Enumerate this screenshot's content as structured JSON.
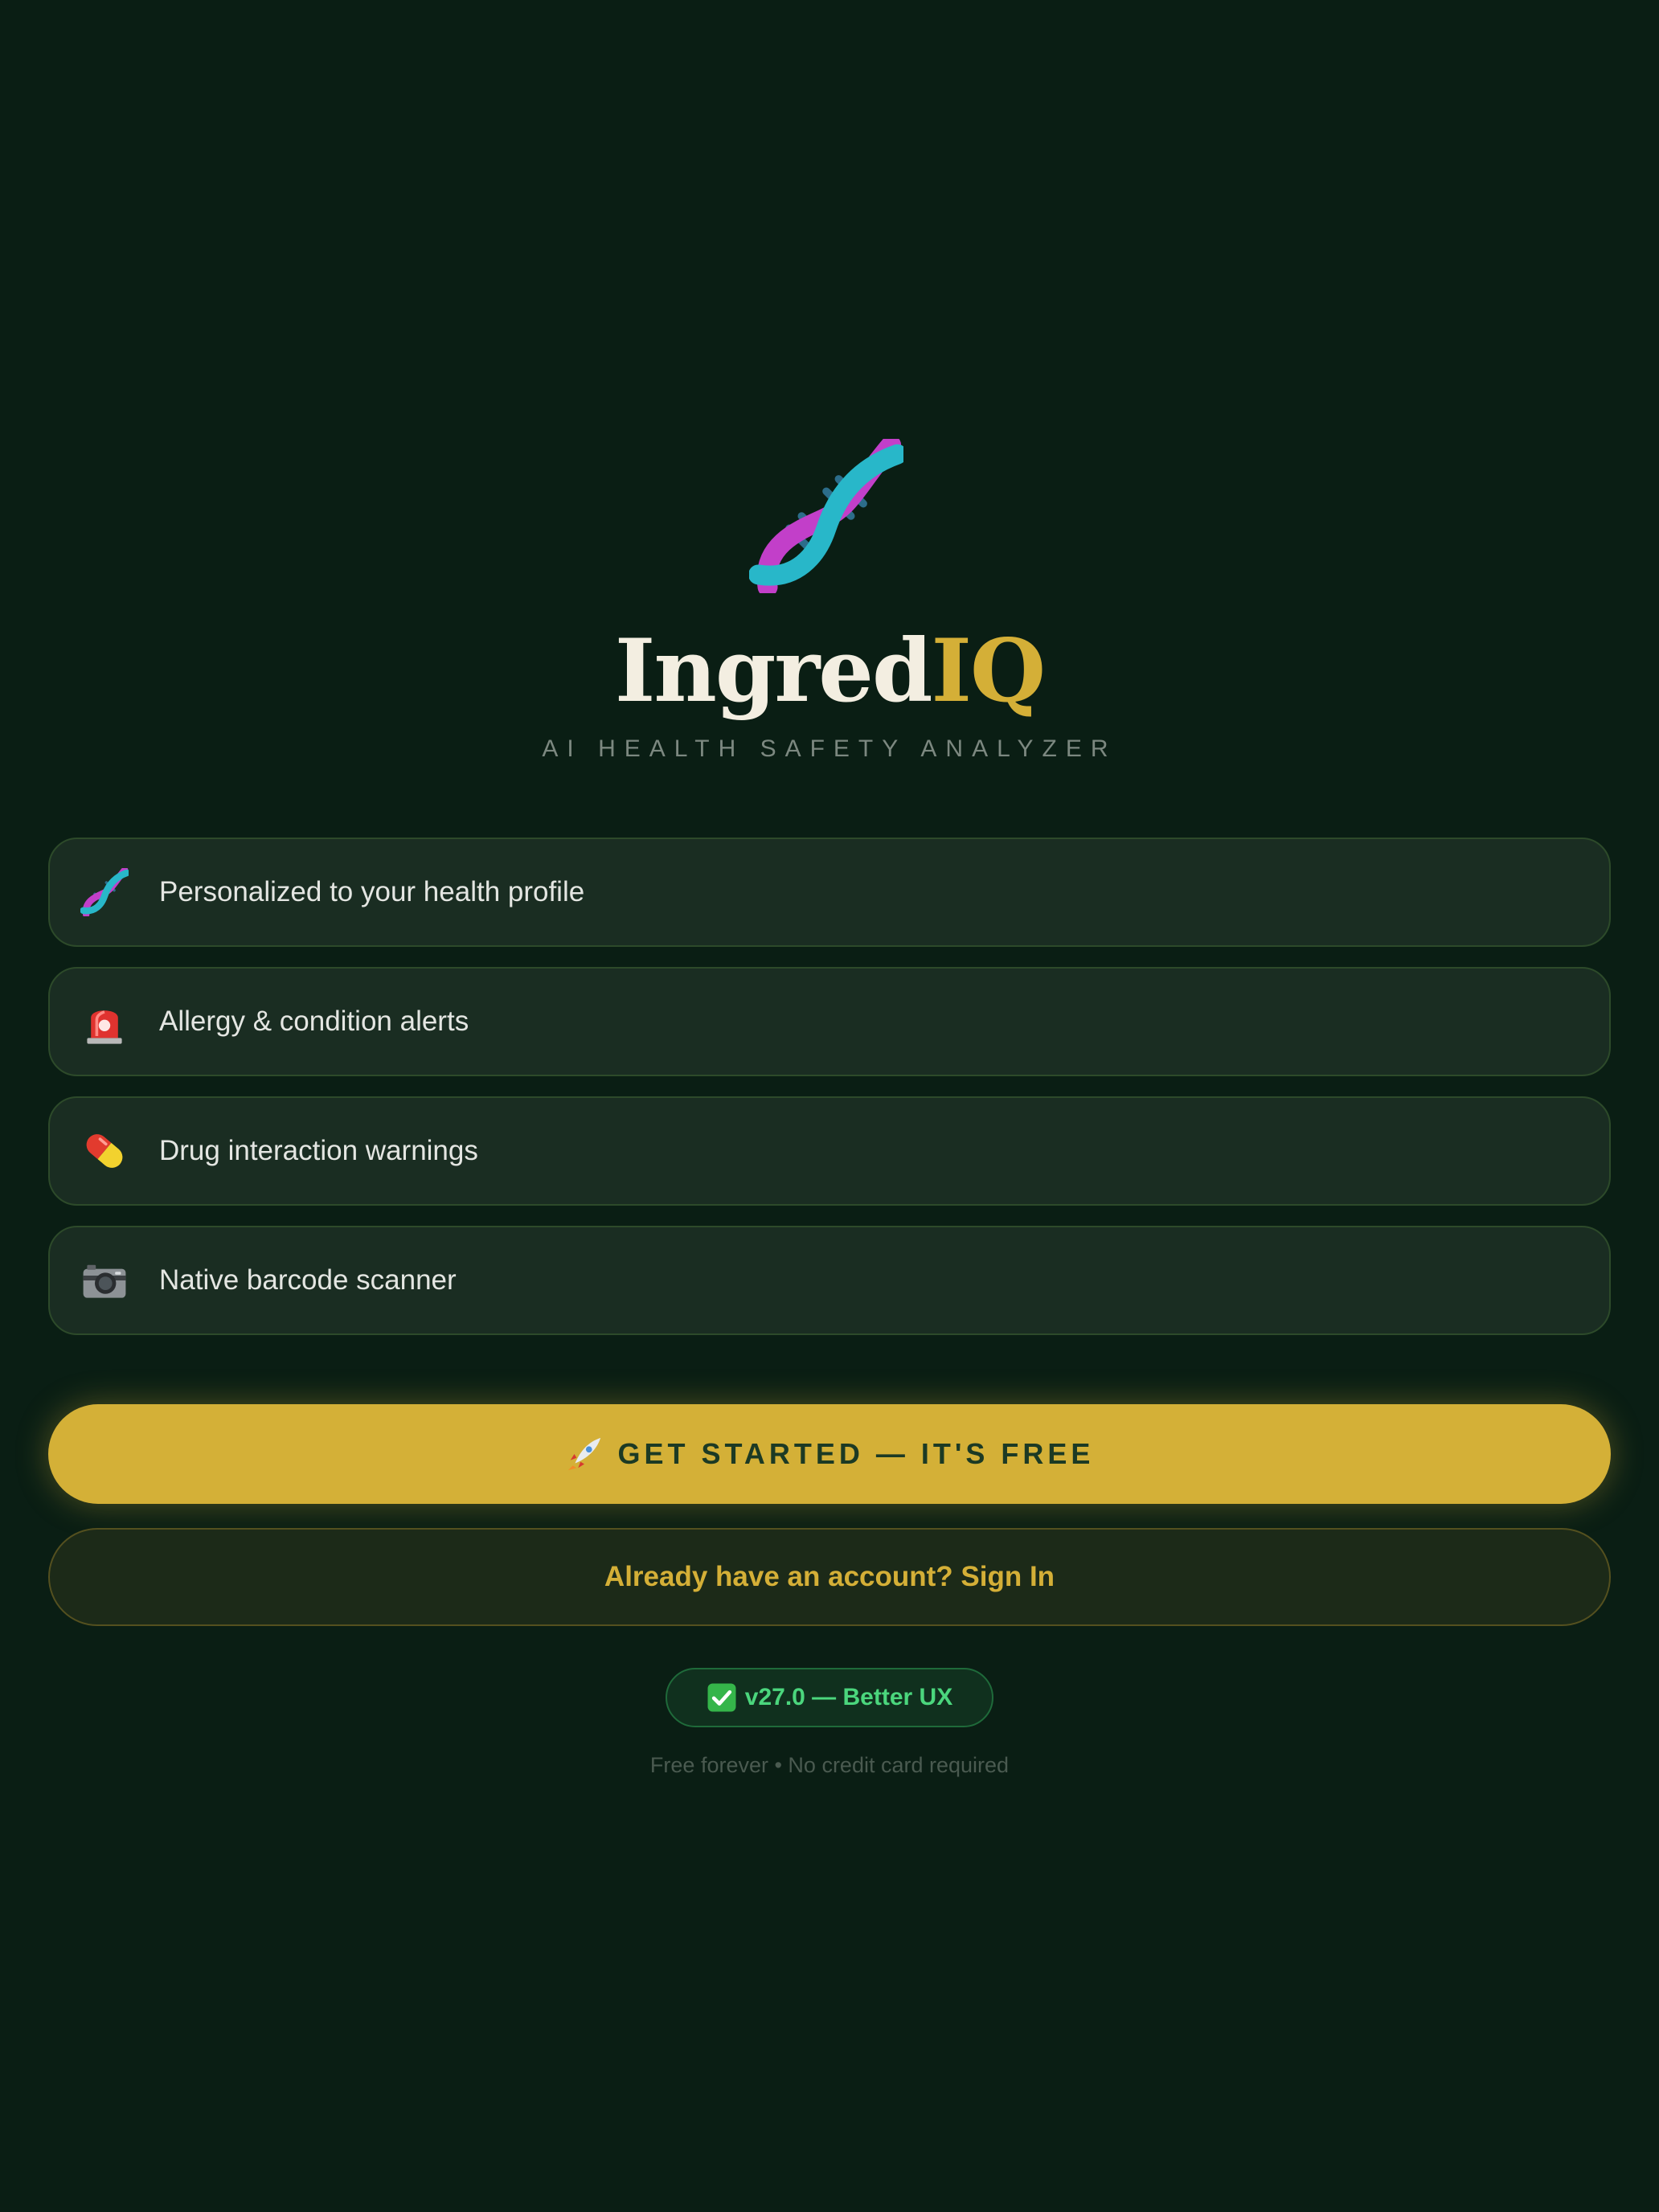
{
  "brand": {
    "name_part1": "Ingred",
    "name_part2": "IQ",
    "tagline": "AI HEALTH SAFETY ANALYZER",
    "logo_icon": "dna-icon"
  },
  "features": [
    {
      "icon": "dna-icon",
      "label": "Personalized to your health profile"
    },
    {
      "icon": "siren-icon",
      "label": "Allergy & condition alerts"
    },
    {
      "icon": "pill-icon",
      "label": "Drug interaction warnings"
    },
    {
      "icon": "camera-icon",
      "label": "Native barcode scanner"
    }
  ],
  "actions": {
    "get_started_icon": "rocket-icon",
    "get_started_label": "GET STARTED — IT'S FREE",
    "sign_in_label": "Already have an account? Sign In"
  },
  "version_badge": {
    "icon": "check-icon",
    "label": "v27.0 — Better UX"
  },
  "footnote": "Free forever • No credit card required",
  "colors": {
    "background": "#0a1e14",
    "accent_gold": "#d4af37",
    "card_bg": "#1a2d22",
    "success_green": "#4bd67d"
  }
}
